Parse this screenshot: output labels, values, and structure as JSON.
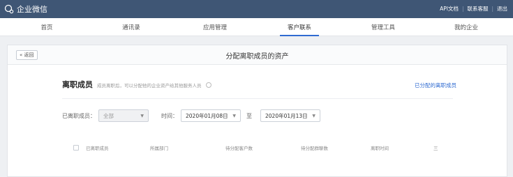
{
  "app": {
    "brand": "企业微信",
    "top_links": [
      "API文档",
      "联系客服",
      "退出"
    ]
  },
  "nav": {
    "items": [
      "首页",
      "通讯录",
      "应用管理",
      "客户联系",
      "管理工具",
      "我的企业"
    ],
    "active": "客户联系"
  },
  "page": {
    "back_label": "« 返回",
    "title": "分配离职成员的资产"
  },
  "section": {
    "title": "离职成员",
    "desc": "成员离职后，可以分配他的企业资产给其他服务人员",
    "assigned_link": "已分配的离职成员"
  },
  "filters": {
    "member_label": "已离职成员：",
    "member_value": "全部",
    "time_label": "时间：",
    "date_from": "2020年01月08日",
    "to_label": "至",
    "date_to": "2020年01月13日"
  },
  "table": {
    "columns": [
      "已离职成员",
      "所属部门",
      "待分配客户数",
      "待分配群聊数",
      "离职时间",
      "三"
    ]
  }
}
